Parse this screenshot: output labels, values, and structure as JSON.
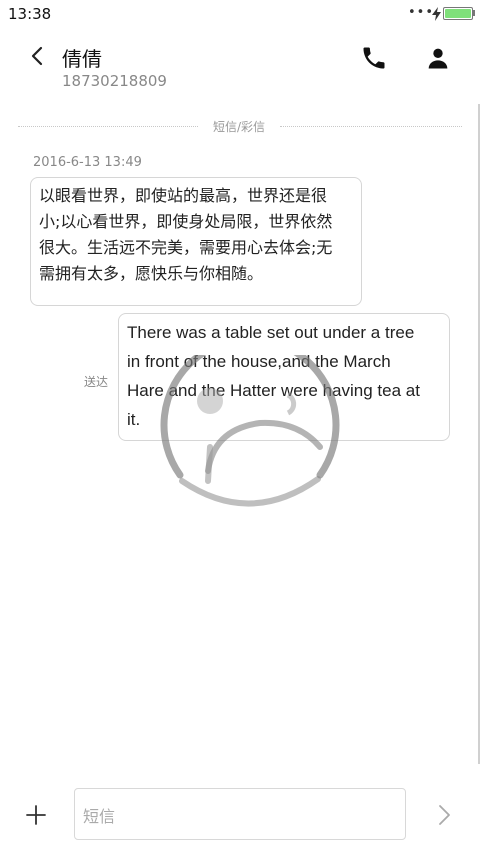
{
  "status_bar": {
    "time": "13:38",
    "signal_dots": "•••",
    "battery_level": 1.0,
    "battery_color": "#7fe07a",
    "icons": [
      "bolt-icon",
      "battery-icon"
    ]
  },
  "header": {
    "name": "倩倩",
    "number": "18730218809",
    "icons": [
      "back-arrow-icon",
      "phone-icon",
      "person-icon"
    ]
  },
  "separator": {
    "label": "短信/彩信"
  },
  "messages": [
    {
      "direction": "incoming",
      "timestamp": "2016-6-13 13:49",
      "lines": [
        "以眼看世界，即使站的最高，世界还是很",
        "小;以心看世界，即使身处局限，世界依然",
        "很大。生活远不完美，需要用心去体会;无",
        "需拥有太多，愿快乐与你相随。"
      ]
    },
    {
      "direction": "outgoing",
      "status": "送达",
      "lines": [
        "There was a table set out under a tree",
        "in front of the house,and the March",
        "Hare and the Hatter were having tea at",
        "it."
      ]
    }
  ],
  "compose": {
    "placeholder": "短信",
    "icons": [
      "plus-icon",
      "send-arrow-icon"
    ]
  }
}
